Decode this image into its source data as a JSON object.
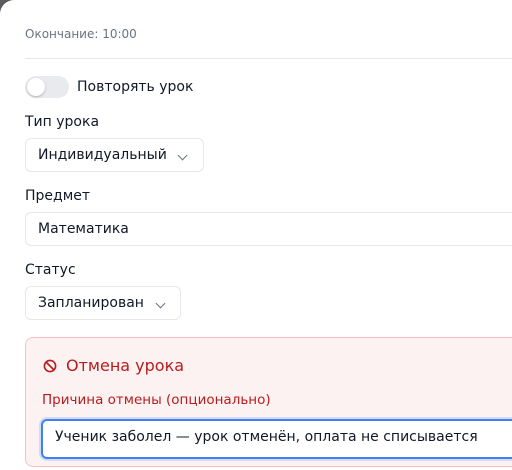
{
  "schedule": {
    "end_time_label": "Окончание: 10:00"
  },
  "repeat": {
    "label": "Повторять урок",
    "enabled": false
  },
  "lesson_type": {
    "label": "Тип урока",
    "value": "Индивидуальный"
  },
  "subject": {
    "label": "Предмет",
    "value": "Математика"
  },
  "status": {
    "label": "Статус",
    "value": "Запланирован"
  },
  "cancellation": {
    "title": "Отмена урока",
    "reason_label": "Причина отмены (опционально)",
    "reason_value": "Ученик заболел — урок отменён, оплата не списывается"
  },
  "colors": {
    "danger": "#b91c1c",
    "focus": "#3b82f6"
  }
}
